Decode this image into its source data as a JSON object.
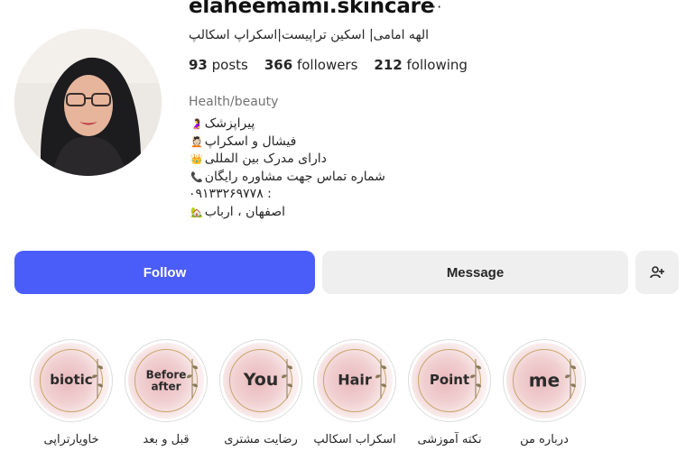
{
  "profile": {
    "username": "elaheemami.skincare",
    "more_icon": "ellipsis-icon",
    "full_name": "الهه امامی| اسکین تراپیست|اسکراپ اسکالپ",
    "stats": {
      "posts_count": "93",
      "posts_label": "posts",
      "followers_count": "366",
      "followers_label": "followers",
      "following_count": "212",
      "following_label": "following"
    },
    "category": "Health/beauty",
    "bio": [
      {
        "emoji": "🤰",
        "text": "پیراپزشک"
      },
      {
        "emoji": "💆🏻",
        "text": "فیشال و اسکراپ"
      },
      {
        "emoji": "👑",
        "text": "دارای مدرک بین المللی"
      },
      {
        "emoji": "📞",
        "text": "شماره تماس جهت مشاوره رایگان"
      },
      {
        "emoji": "",
        "text": "۰۹۱۳۳۲۶۹۷۷۸ :"
      },
      {
        "emoji": "🏡",
        "text": "اصفهان ، ارباب"
      }
    ]
  },
  "actions": {
    "follow_label": "Follow",
    "message_label": "Message",
    "add_user_icon": "person-add-icon"
  },
  "highlights": [
    {
      "word": "biotic",
      "label": "خاویارتراپی"
    },
    {
      "word": "Before after",
      "label": "قبل و بعد"
    },
    {
      "word": "You",
      "label": "رضایت مشتری"
    },
    {
      "word": "Hair",
      "label": "اسکراب اسکالپ"
    },
    {
      "word": "Point",
      "label": "نکته آموزشی"
    },
    {
      "word": "me",
      "label": "درباره من"
    }
  ],
  "colors": {
    "follow_button": "#4a5df9",
    "secondary_button": "#efefef",
    "category_text": "#737373"
  }
}
